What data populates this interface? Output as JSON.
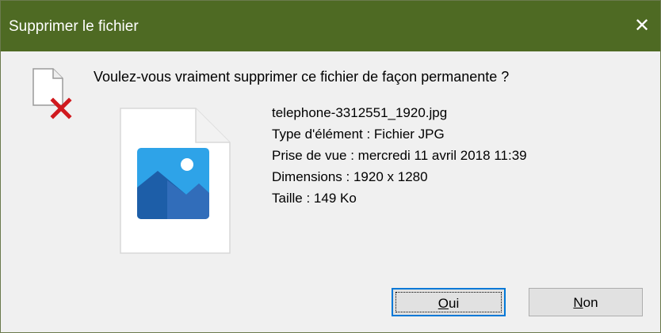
{
  "window": {
    "title": "Supprimer le fichier",
    "close_glyph": "✕"
  },
  "dialog": {
    "question": "Voulez-vous vraiment supprimer ce fichier de façon permanente ?",
    "warning_icon": "file-delete-icon",
    "file_icon": "image-file-icon"
  },
  "file": {
    "name": "telephone-3312551_1920.jpg",
    "type": "Type d'élément : Fichier JPG",
    "date_taken": "Prise de vue : mercredi 11 avril 2018 11:39",
    "dimensions": "Dimensions : 1920 x 1280",
    "size": "Taille : 149 Ko"
  },
  "buttons": {
    "yes": {
      "accel": "O",
      "rest": "ui"
    },
    "no": {
      "accel": "N",
      "rest": "on"
    }
  },
  "colors": {
    "titlebar": "#4e6a23",
    "delete_mark": "#d0191e",
    "focus_border": "#0078d7"
  }
}
